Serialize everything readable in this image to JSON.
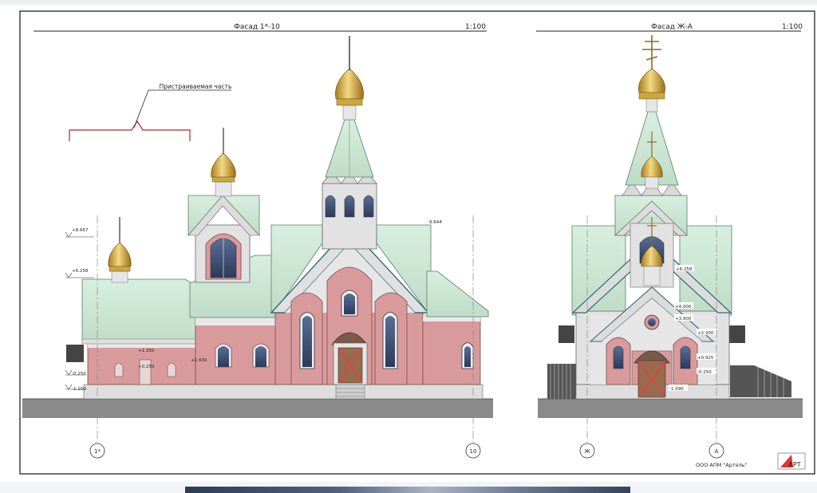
{
  "left_facade": {
    "title": "Фасад 1*-10",
    "scale": "1:100",
    "annotation": "Пристраиваемая часть",
    "axes": [
      "1*",
      "10"
    ],
    "levels": [
      "+8.667",
      "+6.258",
      "+1.250",
      "+0.250",
      "+1.930",
      "-0.250",
      "-1.150",
      "9.644"
    ]
  },
  "right_facade": {
    "title": "Фасад Ж-А",
    "scale": "1:100",
    "axes": [
      "Ж",
      "А"
    ],
    "levels": [
      "+6.258",
      "+4.000",
      "+3.900",
      "+2.300",
      "+0.925",
      "-0.250",
      "-1.090"
    ]
  },
  "company": "ООО АПМ \"Артель\"",
  "logo_text": "АРТ",
  "colors": {
    "roof": "#cfe8d6",
    "wall": "#d99a9c",
    "stucco": "#e8e8e8",
    "dome": "#d9b54a",
    "ground": "#8a8a8a"
  }
}
